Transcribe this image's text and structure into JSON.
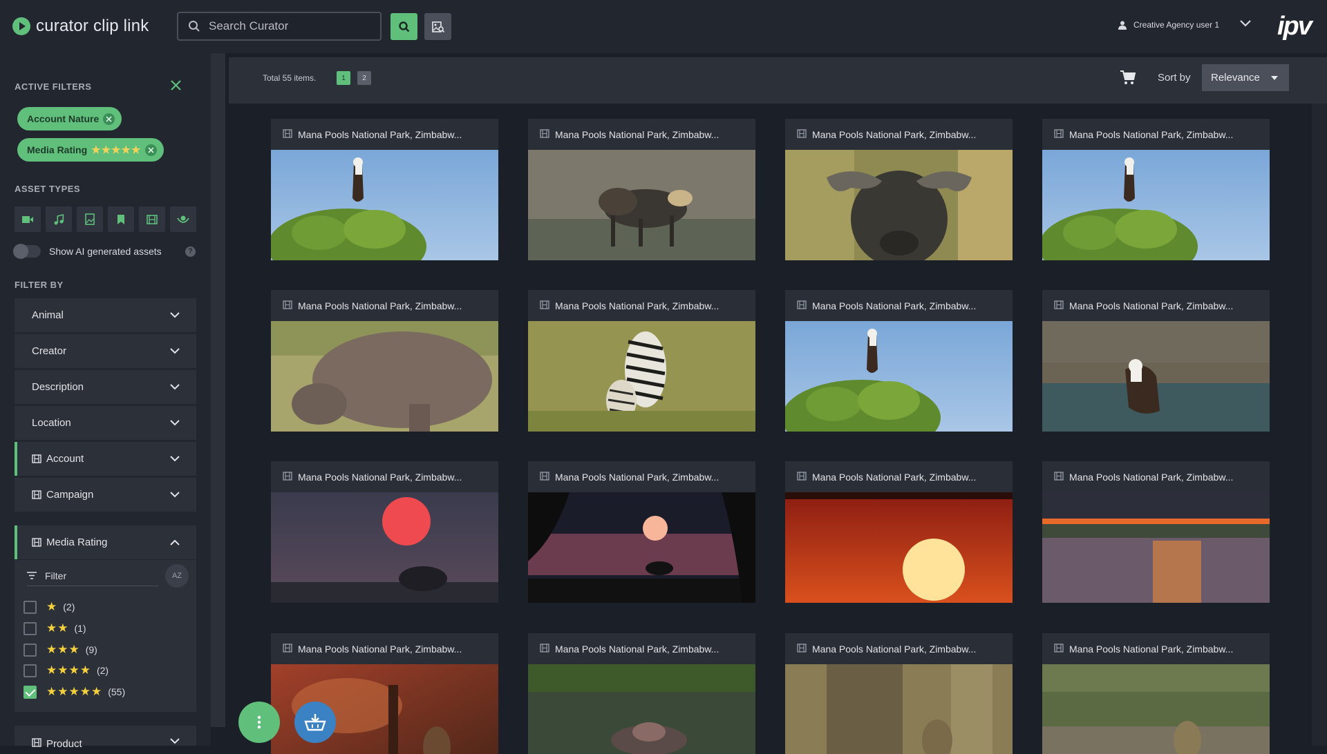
{
  "header": {
    "app_name": "curator clip link",
    "search_placeholder": "Search Curator",
    "user_name": "Creative Agency user 1",
    "brand": "ipv"
  },
  "sidebar": {
    "active_filters_label": "ACTIVE FILTERS",
    "chips": [
      {
        "label": "Account Nature",
        "stars": ""
      },
      {
        "label": "Media Rating",
        "stars": "★★★★★"
      }
    ],
    "asset_types_label": "ASSET TYPES",
    "asset_types": [
      "video-icon",
      "audio-icon",
      "image-icon",
      "bookmark-icon",
      "film-icon",
      "ai-icon"
    ],
    "ai_toggle_label": "Show AI generated assets",
    "help_glyph": "?",
    "filter_by_label": "FILTER BY",
    "filters": [
      {
        "label": "Animal",
        "icon": false,
        "active": false
      },
      {
        "label": "Creator",
        "icon": false,
        "active": false
      },
      {
        "label": "Description",
        "icon": false,
        "active": false
      },
      {
        "label": "Location",
        "icon": false,
        "active": false
      },
      {
        "label": "Account",
        "icon": true,
        "active": true
      },
      {
        "label": "Campaign",
        "icon": true,
        "active": false
      }
    ],
    "media_rating": {
      "label": "Media Rating",
      "filter_label": "Filter",
      "sort_glyph": "AZ",
      "rows": [
        {
          "stars": "★",
          "count": "(2)",
          "checked": false
        },
        {
          "stars": "★★",
          "count": "(1)",
          "checked": false
        },
        {
          "stars": "★★★",
          "count": "(9)",
          "checked": false
        },
        {
          "stars": "★★★★",
          "count": "(2)",
          "checked": false
        },
        {
          "stars": "★★★★★",
          "count": "(55)",
          "checked": true
        }
      ]
    },
    "product_label": "Product"
  },
  "toolbar": {
    "total_label": "Total 55 items.",
    "pages": [
      "1",
      "2"
    ],
    "current_page": "1",
    "sort_label": "Sort by",
    "sort_value": "Relevance"
  },
  "grid": {
    "cards": [
      {
        "title": "Mana Pools National Park, Zimbabw...",
        "scene": "eagle"
      },
      {
        "title": "Mana Pools National Park, Zimbabw...",
        "scene": "dogs"
      },
      {
        "title": "Mana Pools National Park, Zimbabw...",
        "scene": "buffalo"
      },
      {
        "title": "Mana Pools National Park, Zimbabw...",
        "scene": "eagle"
      },
      {
        "title": "Mana Pools National Park, Zimbabw...",
        "scene": "hippo"
      },
      {
        "title": "Mana Pools National Park, Zimbabw...",
        "scene": "zebra"
      },
      {
        "title": "Mana Pools National Park, Zimbabw...",
        "scene": "eagle"
      },
      {
        "title": "Mana Pools National Park, Zimbabw...",
        "scene": "eagle-water"
      },
      {
        "title": "Mana Pools National Park, Zimbabw...",
        "scene": "sunset-pink"
      },
      {
        "title": "Mana Pools National Park, Zimbabw...",
        "scene": "sunset-tree"
      },
      {
        "title": "Mana Pools National Park, Zimbabw...",
        "scene": "sunset-orange"
      },
      {
        "title": "Mana Pools National Park, Zimbabw...",
        "scene": "sunset-river"
      },
      {
        "title": "Mana Pools National Park, Zimbabw...",
        "scene": "baboon-red"
      },
      {
        "title": "Mana Pools National Park, Zimbabw...",
        "scene": "hippo-water"
      },
      {
        "title": "Mana Pools National Park, Zimbabw...",
        "scene": "monkey-tree"
      },
      {
        "title": "Mana Pools National Park, Zimbabw...",
        "scene": "baboon-field"
      }
    ]
  },
  "colors": {
    "accent": "#5fbf7b",
    "background": "#1b1f27",
    "panel": "#22262f",
    "star": "#f4d03f",
    "fab_basket": "#3b82c4"
  }
}
